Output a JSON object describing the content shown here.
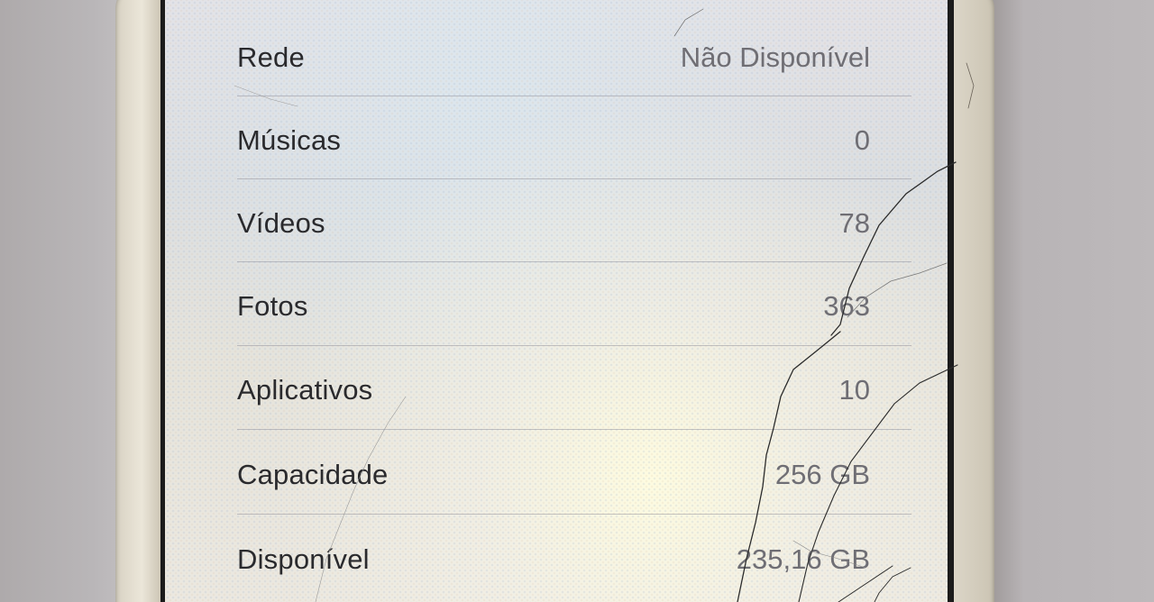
{
  "settings": {
    "rows": [
      {
        "label": "Rede",
        "value": "Não Disponível"
      },
      {
        "label": "Músicas",
        "value": "0"
      },
      {
        "label": "Vídeos",
        "value": "78"
      },
      {
        "label": "Fotos",
        "value": "363"
      },
      {
        "label": "Aplicativos",
        "value": "10"
      },
      {
        "label": "Capacidade",
        "value": "256 GB"
      },
      {
        "label": "Disponível",
        "value": "235,16 GB"
      }
    ]
  },
  "colors": {
    "label_text": "#2a2a2d",
    "value_text": "#6f6e74",
    "separator": "#9696a0"
  }
}
